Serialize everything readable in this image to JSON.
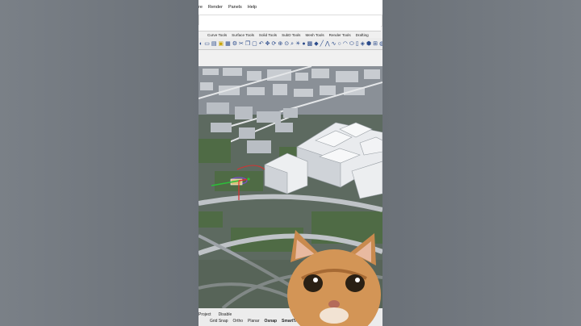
{
  "menu": {
    "items": [
      "re",
      "Render",
      "Panels",
      "Help"
    ]
  },
  "tabs": [
    "Curve Tools",
    "Surface Tools",
    "Solid Tools",
    "SubD Tools",
    "Mesh Tools",
    "Render Tools",
    "Drafting"
  ],
  "toolbar": {
    "icons": [
      "select-icon",
      "new-file-icon",
      "open-icon",
      "save-icon",
      "print-icon",
      "import-icon",
      "cut-icon",
      "copy-icon",
      "paste-icon",
      "undo-icon",
      "pan-icon",
      "rotate-icon",
      "zoom-icon",
      "zoom-window-icon",
      "zoom-extents-icon",
      "light-icon",
      "osnap-icon",
      "grid-icon",
      "point-icon",
      "line-icon",
      "polyline-icon",
      "curve-icon",
      "circle-icon",
      "arc-icon",
      "ellipse-icon",
      "rectangle-icon",
      "surface-icon",
      "solid-icon",
      "mesh-icon",
      "render-icon",
      "help-icon"
    ]
  },
  "status": {
    "row1": [
      "Project",
      "Disable"
    ],
    "row2": [
      {
        "label": "Grid Snap",
        "active": false
      },
      {
        "label": "Ortho",
        "active": false
      },
      {
        "label": "Planar",
        "active": false
      },
      {
        "label": "Osnap",
        "active": true
      },
      {
        "label": "SmartTr",
        "active": true
      }
    ]
  },
  "colors": {
    "background": "#6f757c",
    "panel": "#f0f0f0",
    "gumball_x": "#d93030",
    "gumball_y": "#2bbf3a",
    "gumball_z": "#2a5bd7"
  }
}
